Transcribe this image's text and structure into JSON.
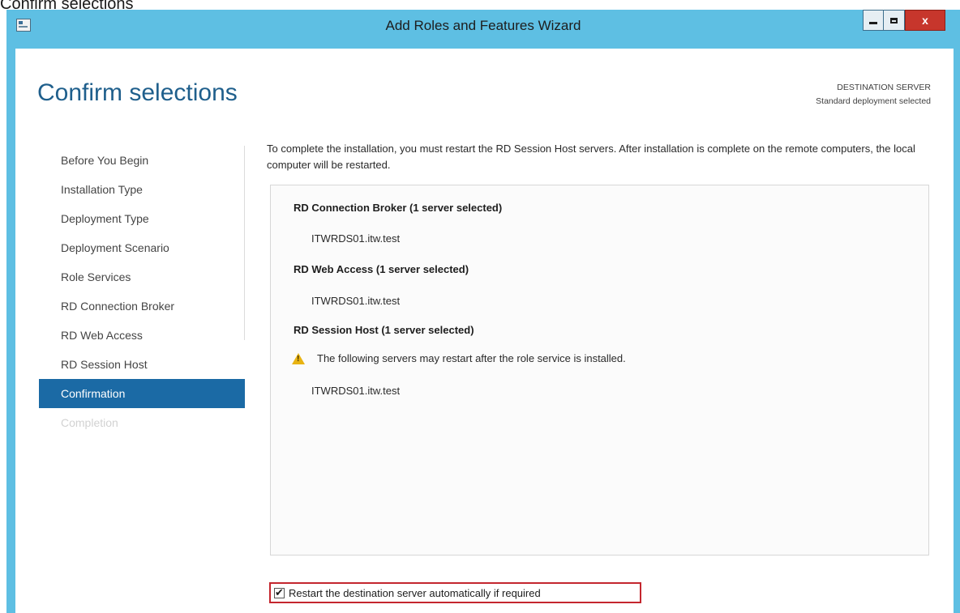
{
  "top_caption": "Confirm selections",
  "window": {
    "title": "Add Roles and Features Wizard",
    "close_glyph": "x"
  },
  "page": {
    "title": "Confirm selections",
    "destination_label": "DESTINATION SERVER",
    "destination_value": "Standard deployment selected"
  },
  "nav": {
    "items": [
      {
        "label": "Before You Begin",
        "state": "normal"
      },
      {
        "label": "Installation Type",
        "state": "normal"
      },
      {
        "label": "Deployment Type",
        "state": "normal"
      },
      {
        "label": "Deployment Scenario",
        "state": "normal"
      },
      {
        "label": "Role Services",
        "state": "normal"
      },
      {
        "label": "RD Connection Broker",
        "state": "normal"
      },
      {
        "label": "RD Web Access",
        "state": "normal"
      },
      {
        "label": "RD Session Host",
        "state": "normal"
      },
      {
        "label": "Confirmation",
        "state": "active"
      },
      {
        "label": "Completion",
        "state": "disabled"
      }
    ]
  },
  "main": {
    "description": "To complete the installation, you must restart the RD Session Host servers. After installation is complete on the remote computers, the local computer will be restarted.",
    "sections": [
      {
        "heading": "RD Connection Broker  (1 server selected)",
        "server": "ITWRDS01.itw.test"
      },
      {
        "heading": "RD Web Access  (1 server selected)",
        "server": "ITWRDS01.itw.test"
      },
      {
        "heading": "RD Session Host  (1 server selected)",
        "warning": "The following servers may restart after the role service is installed.",
        "server": "ITWRDS01.itw.test"
      }
    ],
    "restart_checkbox": {
      "label": "Restart the destination server automatically if required",
      "checked": true
    }
  },
  "colors": {
    "window_frame": "#5ebfe3",
    "title_accent": "#1f5f8c",
    "nav_active": "#1b6aa5",
    "highlight_border": "#c4262e",
    "warning": "#e8b312"
  }
}
